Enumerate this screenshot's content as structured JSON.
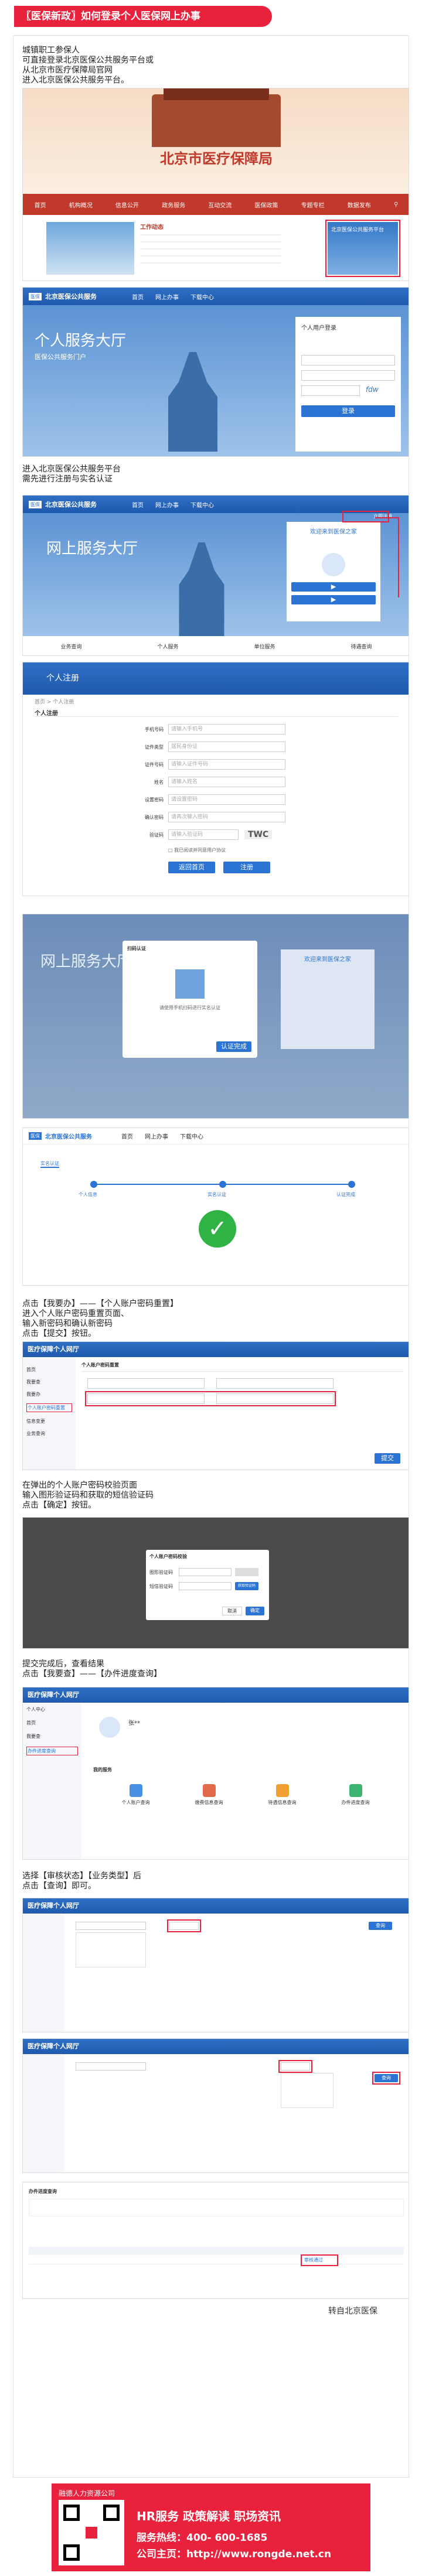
{
  "header": {
    "title": "〖医保新政〗如何登录个人医保网上办事"
  },
  "intro": {
    "lines": [
      "城镇职工参保人",
      "可直接登录北京医保公共服务平台或",
      "从北京市医疗保障局官网",
      "进入北京医保公共服务平台。"
    ]
  },
  "shot1": {
    "site_title": "北京市医疗保障局",
    "nav": [
      "首页",
      "机构概况",
      "信息公开",
      "政务服务",
      "互动交流",
      "医保政策",
      "专题专栏",
      "数据发布"
    ],
    "news_label": "工作动态",
    "side_panel_title": "北京医保公共服务平台"
  },
  "shot2": {
    "brand": "北京医保公共服务",
    "nav": [
      "首页",
      "网上办事",
      "下载中心"
    ],
    "hero_title": "个人服务大厅",
    "hero_sub": "医保公共服务门户",
    "login_title": "个人用户登录",
    "login_button": "登录",
    "captcha": "fdw"
  },
  "para2": {
    "lines": [
      "进入北京医保公共服务平台",
      "需先进行注册与实名认证"
    ]
  },
  "shot3": {
    "brand": "北京医保公共服务",
    "nav": [
      "首页",
      "网上办事",
      "下载中心"
    ],
    "hero_title": "网上服务大厅",
    "panel_title": "欢迎来到医保之家",
    "register_link": "立即注册",
    "tiles": [
      "业务查询",
      "个人服务",
      "单位服务",
      "待遇查询"
    ]
  },
  "shot4": {
    "banner": "个人注册",
    "breadcrumb": "首页 > 个人注册",
    "form_title": "个人注册",
    "fields": [
      {
        "label": "手机号码",
        "placeholder": "请输入手机号"
      },
      {
        "label": "证件类型",
        "placeholder": "居民身份证"
      },
      {
        "label": "证件号码",
        "placeholder": "请输入证件号码"
      },
      {
        "label": "姓名",
        "placeholder": "请输入姓名"
      },
      {
        "label": "设置密码",
        "placeholder": "请设置密码"
      },
      {
        "label": "确认密码",
        "placeholder": "请再次输入密码"
      },
      {
        "label": "验证码",
        "placeholder": "请输入验证码"
      }
    ],
    "captcha": "TWC",
    "agree_text": "我已阅读并同意用户协议",
    "back_button": "返回首页",
    "submit_button": "注册"
  },
  "shot5": {
    "hero_title": "网上服务大厅",
    "panel_title": "欢迎来到医保之家",
    "dialog_title": "扫码认证",
    "dialog_text": "请使用手机扫码进行实名认证",
    "dialog_button": "认证完成"
  },
  "shot6": {
    "brand": "北京医保公共服务",
    "nav": [
      "首页",
      "网上办事",
      "下载中心"
    ],
    "tab": "实名认证",
    "steps": [
      "个人信息",
      "实名认证",
      "认证完成"
    ]
  },
  "para3": {
    "lines": [
      "点击【我要办】——【个人账户密码重置】",
      "进入个人账户密码重置页面、",
      "输入新密码和确认新密码",
      "点击【提交】按钮。"
    ]
  },
  "shot7": {
    "app_title": "医疗保障个人网厅",
    "menu": [
      "首页",
      "我要查",
      "我要办",
      "个人账户密码重置",
      "信息变更",
      "业务查询"
    ],
    "form_title": "个人账户密码重置",
    "submit": "提交"
  },
  "para4": {
    "lines": [
      "在弹出的个人账户密码校验页面",
      "输入图形验证码和获取的短信验证码",
      "点击【确定】按钮。"
    ]
  },
  "shot8": {
    "dialog_title": "个人账户密码校验",
    "row1_label": "图形验证码",
    "row2_label": "短信验证码",
    "sms_button": "获取验证码",
    "cancel": "取消",
    "ok": "确定"
  },
  "para5": {
    "lines": [
      "提交完成后，查看结果",
      "点击【我要查】——【办件进度查询】"
    ]
  },
  "shot9": {
    "app_title": "医疗保障个人网厅",
    "menu": [
      "个人中心",
      "首页",
      "我要查",
      "办件进度查询"
    ],
    "user_name": "张**",
    "section": "我的服务",
    "services": [
      "个人账户查询",
      "缴费信息查询",
      "待遇信息查询",
      "办件进度查询"
    ]
  },
  "para6": {
    "lines": [
      "选择【审核状态】【业务类型】后",
      "点击【查询】即可。"
    ]
  },
  "shot10": {
    "app_title": "医疗保障个人网厅",
    "query": "查询"
  },
  "shot11": {
    "app_title": "医疗保障个人网厅",
    "query": "查询"
  },
  "shot12": {
    "section": "办件进度查询",
    "result": "审核通过"
  },
  "source": "转自北京医保",
  "footer": {
    "company": "融德人力资源公司",
    "tags": "HR服务  政策解读  职场资讯",
    "hotline": "服务热线：400- 600-1685",
    "homepage": "公司主页：http://www.rongde.net.cn"
  },
  "colors": {
    "accent": "#e8213d",
    "brand_blue": "#2b74d4"
  }
}
